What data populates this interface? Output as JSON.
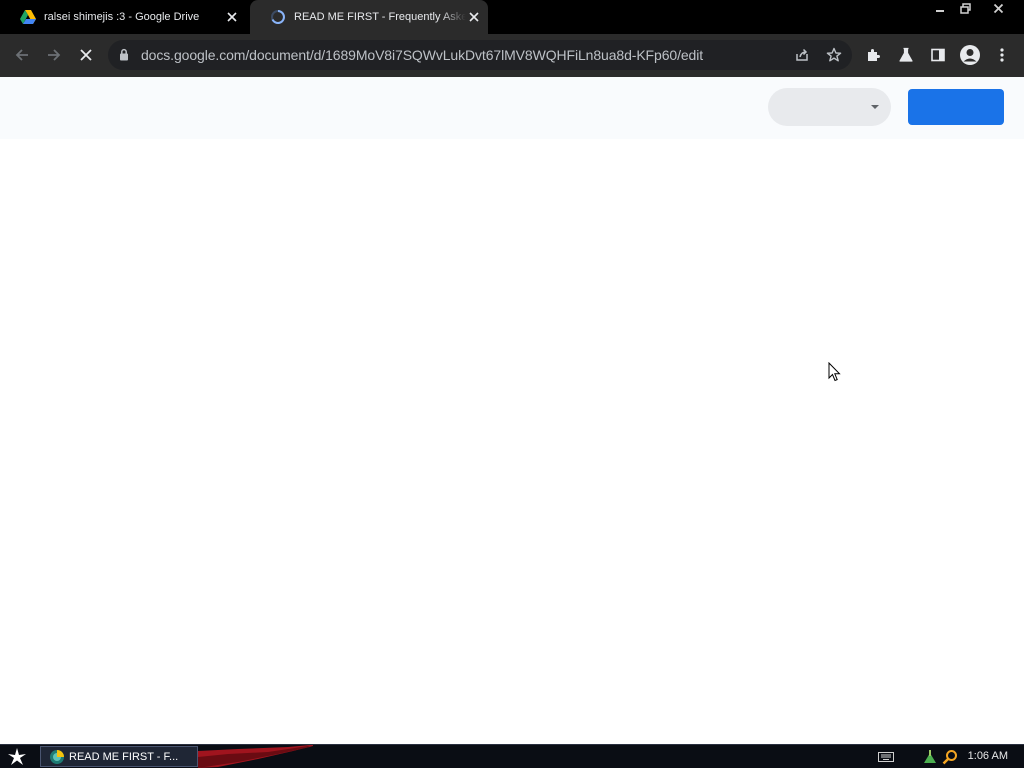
{
  "browser": {
    "tabs": [
      {
        "title": "ralsei shimejis :3 - Google Drive",
        "favicon": "google-drive-icon",
        "active": false
      },
      {
        "title": "READ ME FIRST - Frequently Asked Questions",
        "favicon": "loading-spinner-icon",
        "active": true
      }
    ],
    "url": "docs.google.com/document/d/1689MoV8i7SQWvLukDvt67lMV8WQHFiLn8ua8d-KFp60/edit",
    "loading": true
  },
  "taskbar": {
    "task_label": "READ ME FIRST - F...",
    "clock": "1:06 AM"
  },
  "colors": {
    "share_button": "#1a73e8",
    "chrome_dark": "#2b2b2b",
    "page_header": "#f9fbfd"
  }
}
